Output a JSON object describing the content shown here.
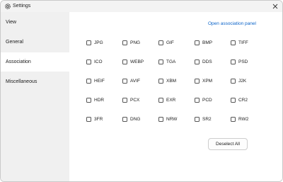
{
  "window": {
    "title": "Settings"
  },
  "sidebar": {
    "items": [
      {
        "label": "View"
      },
      {
        "label": "General"
      },
      {
        "label": "Association",
        "selected": true
      },
      {
        "label": "Miscellaneous"
      }
    ]
  },
  "association": {
    "open_panel_label": "Open association panel",
    "rows": [
      [
        "JPG",
        "PNG",
        "GIF",
        "BMP",
        "TIFF"
      ],
      [
        "ICO",
        "WEBP",
        "TGA",
        "DDS",
        "PSD"
      ],
      [
        "HEIF",
        "AVIF",
        "XBM",
        "XPM",
        "J2K"
      ],
      [
        "HDR",
        "PCX",
        "EXR",
        "PCD",
        "CR2"
      ],
      [
        "3FR",
        "DNG",
        "NRW",
        "SR2",
        "RW2"
      ]
    ],
    "deselect_all_label": "Deselect All"
  },
  "colors": {
    "link": "#0a63c9",
    "sidebar_bg": "#f0f0f0"
  }
}
